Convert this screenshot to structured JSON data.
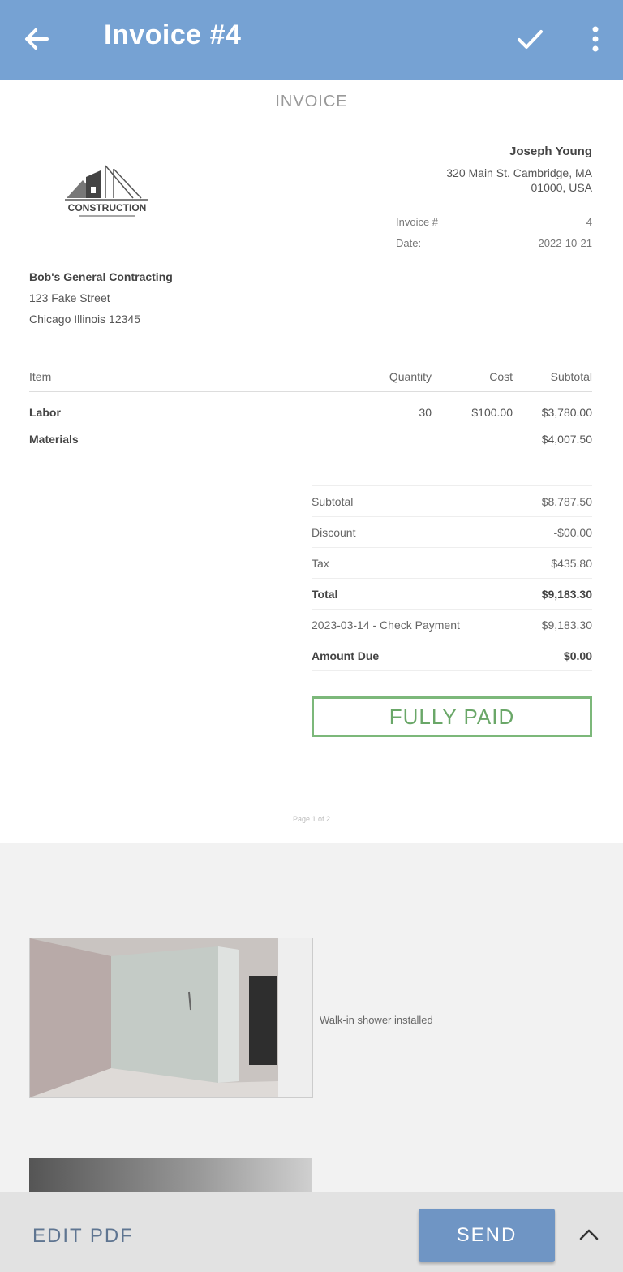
{
  "appbar": {
    "title": "Invoice #4",
    "back_icon": "arrow-left-icon",
    "confirm_icon": "check-icon",
    "more_icon": "more-vert-icon",
    "color": "#76a2d3"
  },
  "invoice": {
    "heading": "INVOICE",
    "logo_text": "CONSTRUCTION",
    "client": {
      "name": "Joseph Young",
      "address_line1": "320 Main St. Cambridge, MA",
      "address_line2": "01000, USA"
    },
    "meta": [
      {
        "label": "Invoice #",
        "value": "4"
      },
      {
        "label": "Date:",
        "value": "2022-10-21"
      }
    ],
    "from": {
      "company": "Bob's General Contracting",
      "street": "123 Fake Street",
      "city": "Chicago Illinois 12345"
    },
    "columns": {
      "item": "Item",
      "quantity": "Quantity",
      "cost": "Cost",
      "subtotal": "Subtotal"
    },
    "items": [
      {
        "name": "Labor",
        "quantity": "30",
        "cost": "$100.00",
        "subtotal": "$3,780.00"
      },
      {
        "name": "Materials",
        "quantity": "",
        "cost": "",
        "subtotal": "$4,007.50"
      }
    ],
    "totals": [
      {
        "label": "Subtotal",
        "value": "$8,787.50"
      },
      {
        "label": "Discount",
        "value": "-$00.00"
      },
      {
        "label": "Tax",
        "value": "$435.80"
      },
      {
        "label": "Total",
        "value": "$9,183.30",
        "bold": true
      },
      {
        "label": "2023-03-14 - Check Payment",
        "value": "$9,183.30"
      },
      {
        "label": "Amount Due",
        "value": "$0.00",
        "bold": true
      }
    ],
    "status": "FULLY PAID",
    "status_color": "#7cb87a",
    "page_footer": "Page 1 of 2"
  },
  "photos": [
    {
      "caption": "Walk-in shower installed"
    }
  ],
  "bottom": {
    "edit_label": "EDIT PDF",
    "send_label": "SEND",
    "expand_icon": "chevron-up-icon"
  }
}
